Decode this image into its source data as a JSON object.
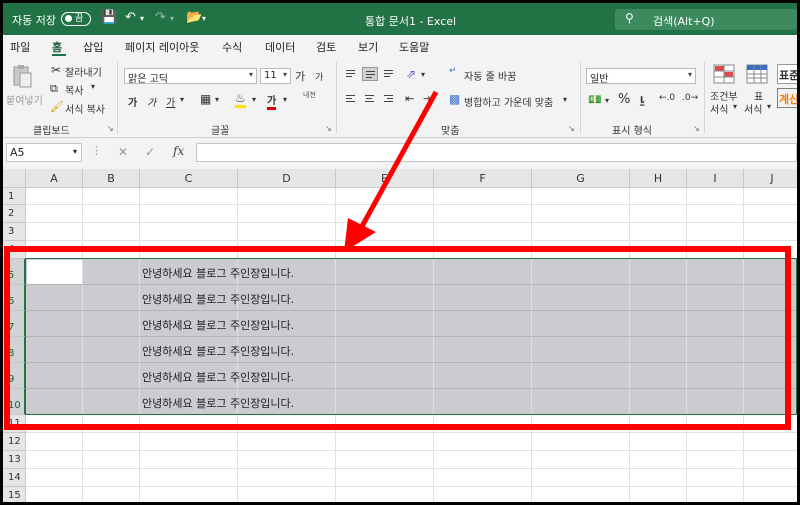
{
  "titlebar": {
    "autosave_label": "자동 저장",
    "autosave_state": "끔",
    "doc_title": "통합 문서1 - Excel",
    "search_placeholder": "검색(Alt+Q)"
  },
  "menu": {
    "items": [
      "파일",
      "홈",
      "삽입",
      "페이지 레이아웃",
      "수식",
      "데이터",
      "검토",
      "보기",
      "도움말"
    ],
    "active_index": 1
  },
  "ribbon": {
    "clipboard": {
      "paste_label": "붙여넣기",
      "cut_label": "잘라내기",
      "copy_label": "복사",
      "format_painter_label": "서식 복사",
      "group_label": "클립보드"
    },
    "font": {
      "font_name": "맑은 고딕",
      "font_size": "11",
      "grow_label": "가",
      "shrink_label": "가",
      "bold_label": "가",
      "italic_label": "가",
      "underline_label": "가",
      "font_color_label": "가",
      "phonetic_label": "내천",
      "group_label": "글꼴"
    },
    "alignment": {
      "wrap_text_label": "자동 줄 바꿈",
      "merge_center_label": "병합하고 가운데 맞춤",
      "group_label": "맞춤"
    },
    "number": {
      "format": "일반",
      "percent_label": "%",
      "group_label": "표시 형식"
    },
    "styles": {
      "conditional_label_1": "조건부",
      "conditional_label_2": "서식",
      "table_label_1": "표",
      "table_label_2": "서식",
      "style_label_1": "표준",
      "style_label_2": "계산"
    }
  },
  "formula_bar": {
    "name_box": "A5",
    "fx_label": "fx",
    "formula_value": ""
  },
  "grid": {
    "columns": [
      "A",
      "B",
      "C",
      "D",
      "E",
      "F",
      "G",
      "H",
      "I",
      "J"
    ],
    "rows": [
      "1",
      "2",
      "3",
      "4",
      "5",
      "6",
      "7",
      "8",
      "9",
      "10",
      "11",
      "12",
      "13",
      "14",
      "15"
    ],
    "selected_rows": [
      "5",
      "6",
      "7",
      "8",
      "9",
      "10"
    ],
    "cells": [
      {
        "ref": "C5",
        "value": "안녕하세요 블로그 주인장입니다."
      },
      {
        "ref": "C6",
        "value": "안녕하세요 블로그 주인장입니다."
      },
      {
        "ref": "C7",
        "value": "안녕하세요 블로그 주인장입니다."
      },
      {
        "ref": "C8",
        "value": "안녕하세요 블로그 주인장입니다."
      },
      {
        "ref": "C9",
        "value": "안녕하세요 블로그 주인장입니다."
      },
      {
        "ref": "C10",
        "value": "안녕하세요 블로그 주인장입니다."
      }
    ]
  },
  "colors": {
    "excel_green": "#217346",
    "annotation_red": "#ff0000",
    "selection_fill": "#cbcbd0"
  }
}
